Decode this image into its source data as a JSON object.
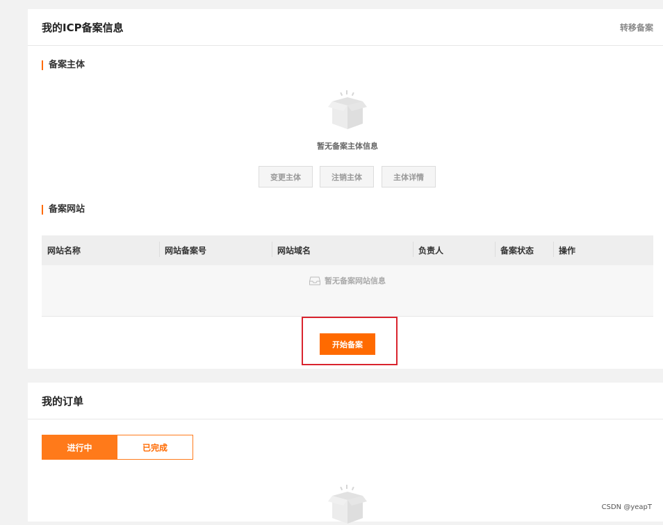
{
  "icp": {
    "title": "我的ICP备案信息",
    "transfer_label": "转移备案",
    "subject_section": "备案主体",
    "subject_empty": "暂无备案主体信息",
    "subject_buttons": [
      "变更主体",
      "注销主体",
      "主体详情"
    ],
    "website_section": "备案网站",
    "table_headers": [
      "网站名称",
      "网站备案号",
      "网站域名",
      "负责人",
      "备案状态",
      "操作"
    ],
    "website_empty": "暂无备案网站信息",
    "start_label": "开始备案"
  },
  "orders": {
    "title": "我的订单",
    "tabs": [
      "进行中",
      "已完成"
    ],
    "active_tab": "进行中"
  },
  "watermark": "CSDN @yeapT",
  "colors": {
    "accent": "#ff6a00",
    "highlight": "#d9232d"
  }
}
